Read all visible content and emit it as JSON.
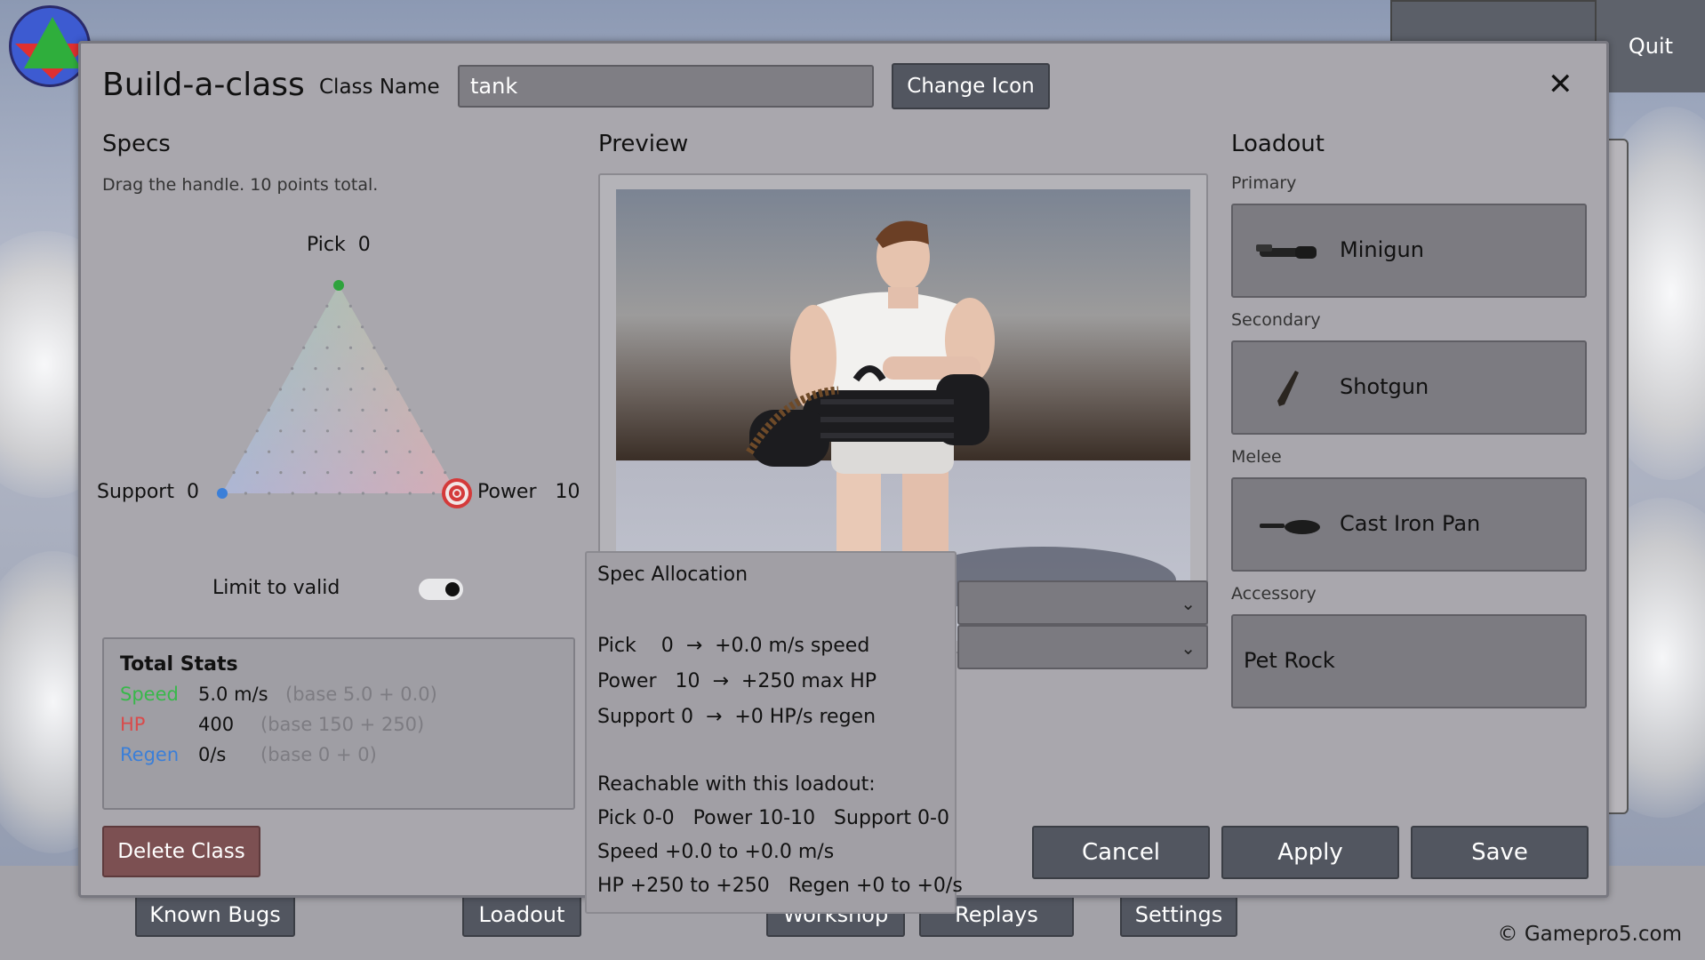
{
  "background": {
    "top_buttons": [
      {
        "label": ""
      }
    ],
    "quit_label": "Quit",
    "bottom_nav": [
      {
        "label": "Known Bugs"
      },
      {
        "label": "Loadout"
      },
      {
        "label": "Workshop"
      },
      {
        "label": "Replays"
      },
      {
        "label": "Settings"
      }
    ],
    "copyright": "© Gamepro5.com"
  },
  "dialog": {
    "title": "Build-a-class",
    "class_name_label": "Class Name",
    "class_name_value": "tank",
    "change_icon_label": "Change Icon",
    "close_icon": "close-icon"
  },
  "specs": {
    "heading": "Specs",
    "hint": "Drag the handle. 10 points total.",
    "vertices": {
      "pick": {
        "label": "Pick",
        "value": "0",
        "color": "#2fa33d"
      },
      "support": {
        "label": "Support",
        "value": "0",
        "color": "#3b7fd8"
      },
      "power": {
        "label": "Power",
        "value": "10",
        "color": "#d43a3a"
      }
    },
    "limit_label": "Limit to valid",
    "limit_enabled": true,
    "handle": "power"
  },
  "total_stats": {
    "title": "Total Stats",
    "rows": [
      {
        "name": "Speed",
        "value": "5.0 m/s",
        "base": "(base 5.0 + 0.0)",
        "color": "#38b84a"
      },
      {
        "name": "HP",
        "value": "400",
        "base": "(base 150 + 250)",
        "color": "#d94b4b"
      },
      {
        "name": "Regen",
        "value": "0/s",
        "base": "(base 0 + 0)",
        "color": "#3b7fd8"
      }
    ]
  },
  "delete_label": "Delete Class",
  "preview": {
    "heading": "Preview"
  },
  "actions": {
    "cancel": "Cancel",
    "apply": "Apply",
    "save": "Save"
  },
  "loadout": {
    "heading": "Loadout",
    "slots": [
      {
        "slot": "Primary",
        "item": "Minigun",
        "icon": "minigun-icon"
      },
      {
        "slot": "Secondary",
        "item": "Shotgun",
        "icon": "shotgun-icon"
      },
      {
        "slot": "Melee",
        "item": "Cast Iron Pan",
        "icon": "pan-icon"
      },
      {
        "slot": "Accessory",
        "item": "Pet Rock",
        "icon": ""
      }
    ]
  },
  "tooltip": {
    "title": "Spec Allocation",
    "lines": [
      "Pick    0  →  +0.0 m/s speed",
      "Power   10  →  +250 max HP",
      "Support 0  →  +0 HP/s regen",
      "Reachable with this loadout:",
      "Pick 0-0   Power 10-10   Support 0-0",
      "Speed +0.0 to +0.0 m/s",
      "HP +250 to +250   Regen +0 to +0/s"
    ]
  }
}
